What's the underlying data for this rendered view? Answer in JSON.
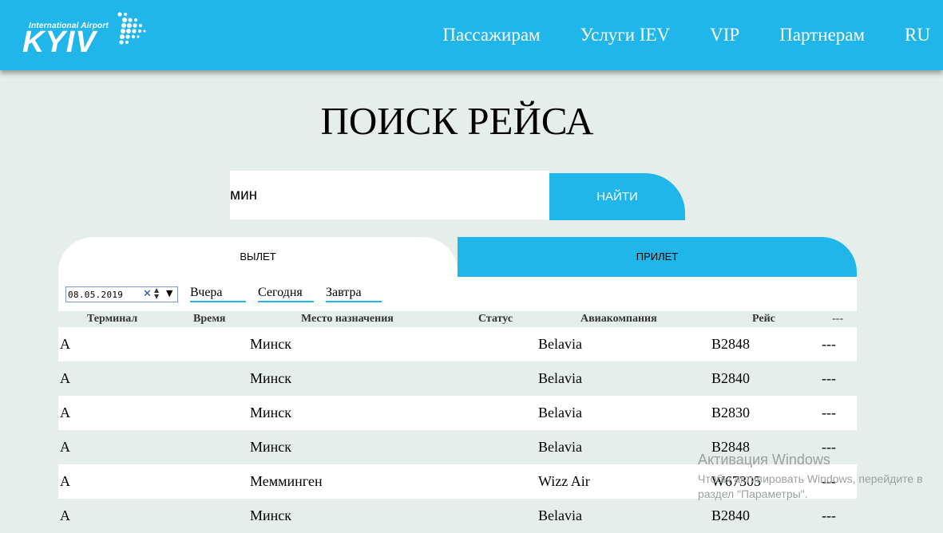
{
  "header": {
    "logo_small": "International Airport",
    "logo_big": "KYIV",
    "nav": [
      "Пассажирам",
      "Услуги IEV",
      "VIP",
      "Партнерам",
      "RU"
    ]
  },
  "page_title": "ПОИСК РЕЙСА",
  "search": {
    "value": "мин",
    "button": "НАЙТИ"
  },
  "tabs": {
    "departure": "ВЫЛЕТ",
    "arrival": "ПРИЛЕТ"
  },
  "date_filter": {
    "date": "08.05.2019",
    "yesterday": "Вчера",
    "today": "Сегодня",
    "tomorrow": "Завтра"
  },
  "table": {
    "headers": [
      "Терминал",
      "Время",
      "Место назначения",
      "Статус",
      "Авиакомпания",
      "Рейс",
      "---"
    ],
    "rows": [
      {
        "terminal": "A",
        "destination": "Минск",
        "airline": "Belavia",
        "flight": "B2848",
        "extra": "---"
      },
      {
        "terminal": "A",
        "destination": "Минск",
        "airline": "Belavia",
        "flight": "B2840",
        "extra": "---"
      },
      {
        "terminal": "A",
        "destination": "Минск",
        "airline": "Belavia",
        "flight": "B2830",
        "extra": "---"
      },
      {
        "terminal": "A",
        "destination": "Минск",
        "airline": "Belavia",
        "flight": "B2848",
        "extra": "---"
      },
      {
        "terminal": "A",
        "destination": "Мемминген",
        "airline": "Wizz Air",
        "flight": "W67305",
        "extra": "---"
      },
      {
        "terminal": "A",
        "destination": "Минск",
        "airline": "Belavia",
        "flight": "B2840",
        "extra": "---"
      }
    ]
  },
  "watermark": {
    "title": "Активация Windows",
    "text": "Чтобы активировать Windows, перейдите в раздел \"Параметры\"."
  },
  "colors": {
    "accent": "#21b6ea",
    "background": "#e6eeeb",
    "row_white": "#ffffff"
  }
}
